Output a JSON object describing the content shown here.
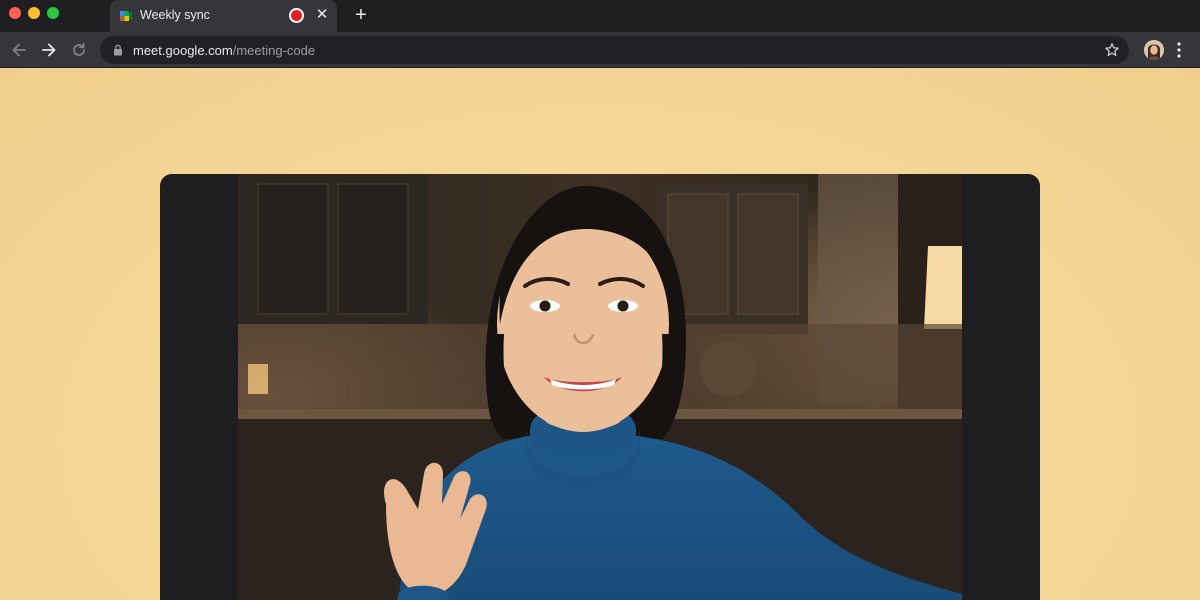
{
  "browser": {
    "tab": {
      "title": "Weekly sync",
      "favicon": "google-meet-icon",
      "recording_indicator": "record-dot-icon",
      "close_icon": "close-icon"
    },
    "new_tab_icon": "plus-icon",
    "nav": {
      "back_icon": "arrow-left-icon",
      "forward_icon": "arrow-right-icon",
      "reload_icon": "reload-icon"
    },
    "address_bar": {
      "url_host": "meet.google.com",
      "url_path": "/meeting-code",
      "lock_icon": "lock-icon",
      "bookmark_icon": "star-icon"
    },
    "profile_icon": "avatar",
    "menu_icon": "kebab-menu-icon"
  },
  "meeting": {
    "participant_video": "participant-video-feed"
  },
  "colors": {
    "page_background": "#f6d9a0",
    "chrome_dark": "#1f1f21",
    "chrome_toolbar": "#35363a",
    "recording_red": "#ea1b1b",
    "video_tile": "#1e1e20"
  }
}
